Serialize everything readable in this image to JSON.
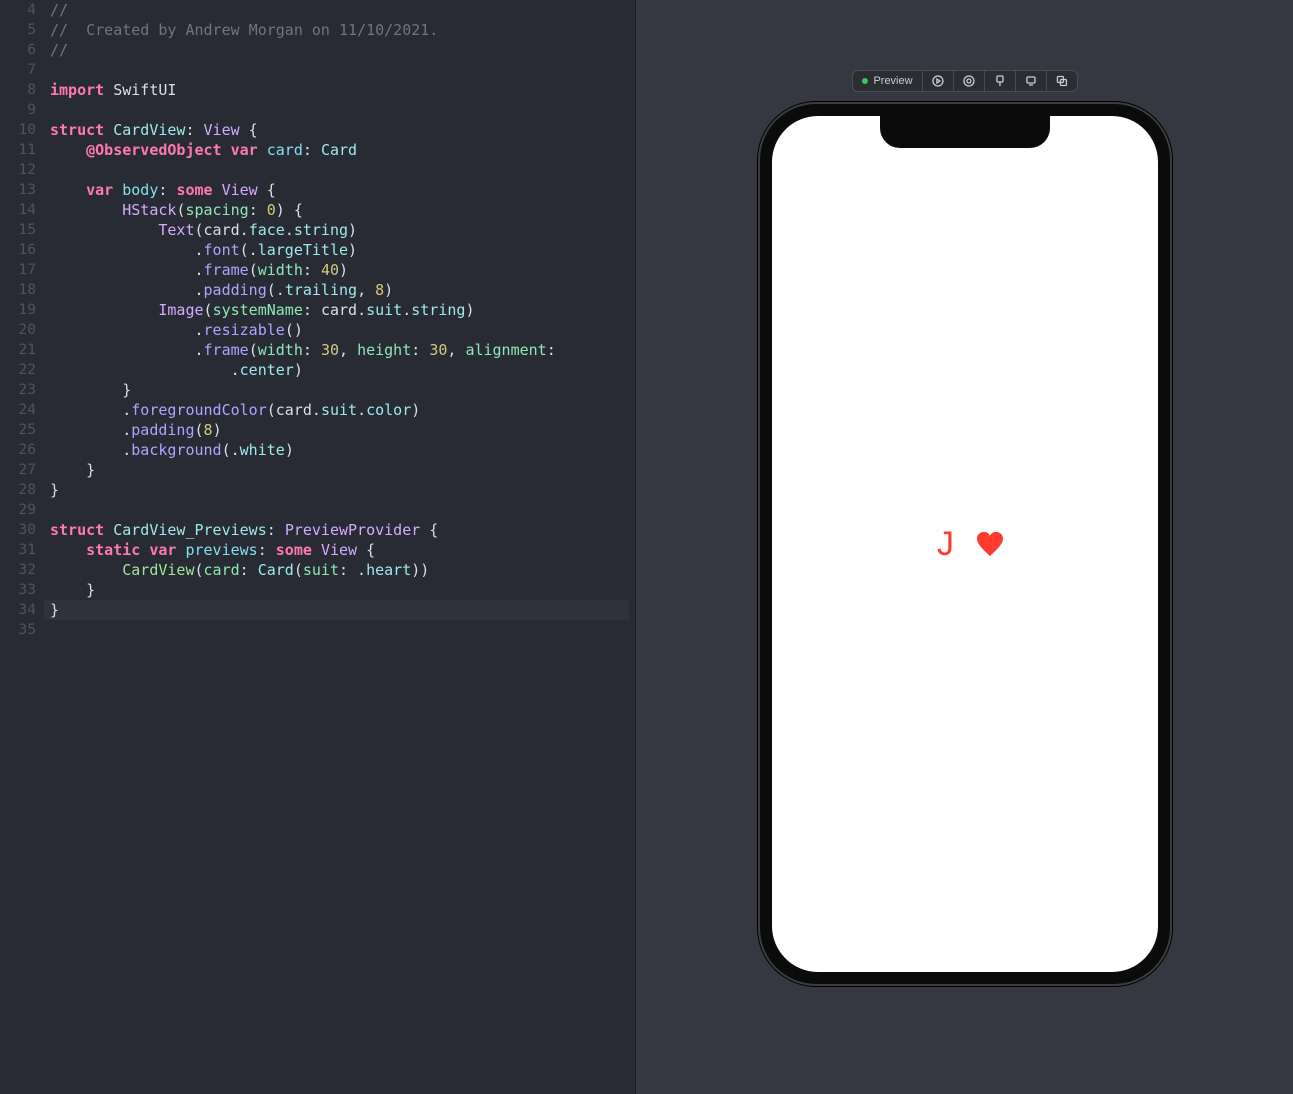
{
  "editor": {
    "first_line_number": 4,
    "highlighted_line": 34,
    "lines": [
      [
        [
          "comment",
          "//"
        ]
      ],
      [
        [
          "comment",
          "//  Created by Andrew Morgan on 11/10/2021."
        ]
      ],
      [
        [
          "comment",
          "//"
        ]
      ],
      [],
      [
        [
          "kw",
          "import"
        ],
        [
          "s",
          " "
        ],
        [
          "ident",
          "SwiftUI"
        ]
      ],
      [],
      [
        [
          "kw",
          "struct"
        ],
        [
          "s",
          " "
        ],
        [
          "type",
          "CardView"
        ],
        [
          "punc",
          ": "
        ],
        [
          "typedk",
          "View"
        ],
        [
          "punc",
          " {"
        ]
      ],
      [
        [
          "s",
          "    "
        ],
        [
          "kw",
          "@ObservedObject"
        ],
        [
          "s",
          " "
        ],
        [
          "kw",
          "var"
        ],
        [
          "s",
          " "
        ],
        [
          "prop",
          "card"
        ],
        [
          "punc",
          ": "
        ],
        [
          "type",
          "Card"
        ]
      ],
      [],
      [
        [
          "s",
          "    "
        ],
        [
          "kw",
          "var"
        ],
        [
          "s",
          " "
        ],
        [
          "prop",
          "body"
        ],
        [
          "punc",
          ": "
        ],
        [
          "kw",
          "some"
        ],
        [
          "s",
          " "
        ],
        [
          "typedk",
          "View"
        ],
        [
          "punc",
          " {"
        ]
      ],
      [
        [
          "s",
          "        "
        ],
        [
          "typedk",
          "HStack"
        ],
        [
          "punc",
          "("
        ],
        [
          "param",
          "spacing"
        ],
        [
          "punc",
          ": "
        ],
        [
          "num",
          "0"
        ],
        [
          "punc",
          ") {"
        ]
      ],
      [
        [
          "s",
          "            "
        ],
        [
          "typedk",
          "Text"
        ],
        [
          "punc",
          "("
        ],
        [
          "ident",
          "card"
        ],
        [
          "punc",
          "."
        ],
        [
          "member",
          "face"
        ],
        [
          "punc",
          "."
        ],
        [
          "member",
          "string"
        ],
        [
          "punc",
          ")"
        ]
      ],
      [
        [
          "s",
          "                "
        ],
        [
          "punc",
          "."
        ],
        [
          "func",
          "font"
        ],
        [
          "punc",
          "(."
        ],
        [
          "member",
          "largeTitle"
        ],
        [
          "punc",
          ")"
        ]
      ],
      [
        [
          "s",
          "                "
        ],
        [
          "punc",
          "."
        ],
        [
          "func",
          "frame"
        ],
        [
          "punc",
          "("
        ],
        [
          "param",
          "width"
        ],
        [
          "punc",
          ": "
        ],
        [
          "num",
          "40"
        ],
        [
          "punc",
          ")"
        ]
      ],
      [
        [
          "s",
          "                "
        ],
        [
          "punc",
          "."
        ],
        [
          "func",
          "padding"
        ],
        [
          "punc",
          "(."
        ],
        [
          "member",
          "trailing"
        ],
        [
          "punc",
          ", "
        ],
        [
          "num",
          "8"
        ],
        [
          "punc",
          ")"
        ]
      ],
      [
        [
          "s",
          "            "
        ],
        [
          "typedk",
          "Image"
        ],
        [
          "punc",
          "("
        ],
        [
          "param",
          "systemName"
        ],
        [
          "punc",
          ": "
        ],
        [
          "ident",
          "card"
        ],
        [
          "punc",
          "."
        ],
        [
          "member",
          "suit"
        ],
        [
          "punc",
          "."
        ],
        [
          "member",
          "string"
        ],
        [
          "punc",
          ")"
        ]
      ],
      [
        [
          "s",
          "                "
        ],
        [
          "punc",
          "."
        ],
        [
          "func",
          "resizable"
        ],
        [
          "punc",
          "()"
        ]
      ],
      [
        [
          "s",
          "                "
        ],
        [
          "punc",
          "."
        ],
        [
          "func",
          "frame"
        ],
        [
          "punc",
          "("
        ],
        [
          "param",
          "width"
        ],
        [
          "punc",
          ": "
        ],
        [
          "num",
          "30"
        ],
        [
          "punc",
          ", "
        ],
        [
          "param",
          "height"
        ],
        [
          "punc",
          ": "
        ],
        [
          "num",
          "30"
        ],
        [
          "punc",
          ", "
        ],
        [
          "param",
          "alignment"
        ],
        [
          "punc",
          ":"
        ]
      ],
      [
        [
          "s",
          "                    "
        ],
        [
          "punc",
          "."
        ],
        [
          "member",
          "center"
        ],
        [
          "punc",
          ")"
        ]
      ],
      [
        [
          "s",
          "        "
        ],
        [
          "punc",
          "}"
        ]
      ],
      [
        [
          "s",
          "        "
        ],
        [
          "punc",
          "."
        ],
        [
          "func",
          "foregroundColor"
        ],
        [
          "punc",
          "("
        ],
        [
          "ident",
          "card"
        ],
        [
          "punc",
          "."
        ],
        [
          "member",
          "suit"
        ],
        [
          "punc",
          "."
        ],
        [
          "member",
          "color"
        ],
        [
          "punc",
          ")"
        ]
      ],
      [
        [
          "s",
          "        "
        ],
        [
          "punc",
          "."
        ],
        [
          "func",
          "padding"
        ],
        [
          "punc",
          "("
        ],
        [
          "num",
          "8"
        ],
        [
          "punc",
          ")"
        ]
      ],
      [
        [
          "s",
          "        "
        ],
        [
          "punc",
          "."
        ],
        [
          "func",
          "background"
        ],
        [
          "punc",
          "(."
        ],
        [
          "member",
          "white"
        ],
        [
          "punc",
          ")"
        ]
      ],
      [
        [
          "s",
          "    "
        ],
        [
          "punc",
          "}"
        ]
      ],
      [
        [
          "punc",
          "}"
        ]
      ],
      [],
      [
        [
          "kw",
          "struct"
        ],
        [
          "s",
          " "
        ],
        [
          "type",
          "CardView_Previews"
        ],
        [
          "punc",
          ": "
        ],
        [
          "typedk",
          "PreviewProvider"
        ],
        [
          "punc",
          " {"
        ]
      ],
      [
        [
          "s",
          "    "
        ],
        [
          "kw",
          "static"
        ],
        [
          "s",
          " "
        ],
        [
          "kw",
          "var"
        ],
        [
          "s",
          " "
        ],
        [
          "prop",
          "previews"
        ],
        [
          "punc",
          ": "
        ],
        [
          "kw",
          "some"
        ],
        [
          "s",
          " "
        ],
        [
          "typedk",
          "View"
        ],
        [
          "punc",
          " {"
        ]
      ],
      [
        [
          "s",
          "        "
        ],
        [
          "ufunc",
          "CardView"
        ],
        [
          "punc",
          "("
        ],
        [
          "param",
          "card"
        ],
        [
          "punc",
          ": "
        ],
        [
          "type",
          "Card"
        ],
        [
          "punc",
          "("
        ],
        [
          "param",
          "suit"
        ],
        [
          "punc",
          ": ."
        ],
        [
          "member",
          "heart"
        ],
        [
          "punc",
          "))"
        ]
      ],
      [
        [
          "s",
          "    "
        ],
        [
          "punc",
          "}"
        ]
      ],
      [
        [
          "punc",
          "}"
        ]
      ],
      []
    ]
  },
  "preview_toolbar": {
    "label": "Preview",
    "icons": [
      "live-icon",
      "variants-icon",
      "pin-icon",
      "device-icon",
      "duplicate-icon"
    ]
  },
  "preview_content": {
    "face": "J",
    "suit": "heart",
    "color": "#ff3b30"
  }
}
